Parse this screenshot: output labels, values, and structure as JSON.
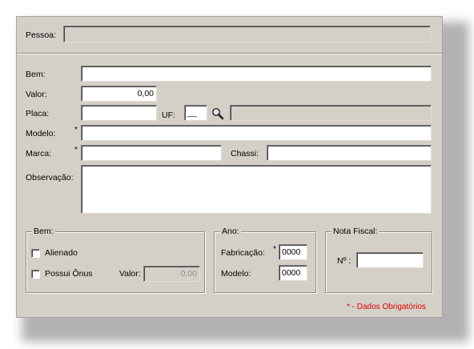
{
  "header": {
    "pessoa_label": "Pessoa:",
    "pessoa_value": ""
  },
  "form": {
    "bem_label": "Bem:",
    "bem_value": "",
    "valor_label": "Valor:",
    "valor_value": "0,00",
    "placa_label": "Placa:",
    "placa_value": "",
    "uf_label": "UF:",
    "uf_value": "__",
    "placa_desc_value": "",
    "modelo_label": "Modelo:",
    "modelo_required": "*",
    "modelo_value": "",
    "marca_label": "Marca:",
    "marca_required": "*",
    "marca_value": "",
    "chassi_label": "Chassi:",
    "chassi_value": "",
    "observacao_label": "Observação:",
    "observacao_value": ""
  },
  "bem_group": {
    "title": "Bem:",
    "alienado_label": "Alienado",
    "alienado_checked": false,
    "onus_label": "Possui Ônus",
    "onus_checked": false,
    "valor_label": "Valor:",
    "valor_value": "0,00"
  },
  "ano_group": {
    "title": "Ano:",
    "fabricacao_label": "Fabricação:",
    "fabricacao_required": "*",
    "fabricacao_value": "0000",
    "modelo_label": "Modelo:",
    "modelo_value": "0000"
  },
  "nota_group": {
    "title": "Nota Fiscal:",
    "numero_label": "Nº :",
    "numero_value": ""
  },
  "footer": {
    "required_note": "* - Dados Obrigatórios"
  },
  "colors": {
    "panel": "#d4d0c8",
    "required_note": "#e00000"
  },
  "icons": {
    "lookup": "magnifier-icon"
  }
}
